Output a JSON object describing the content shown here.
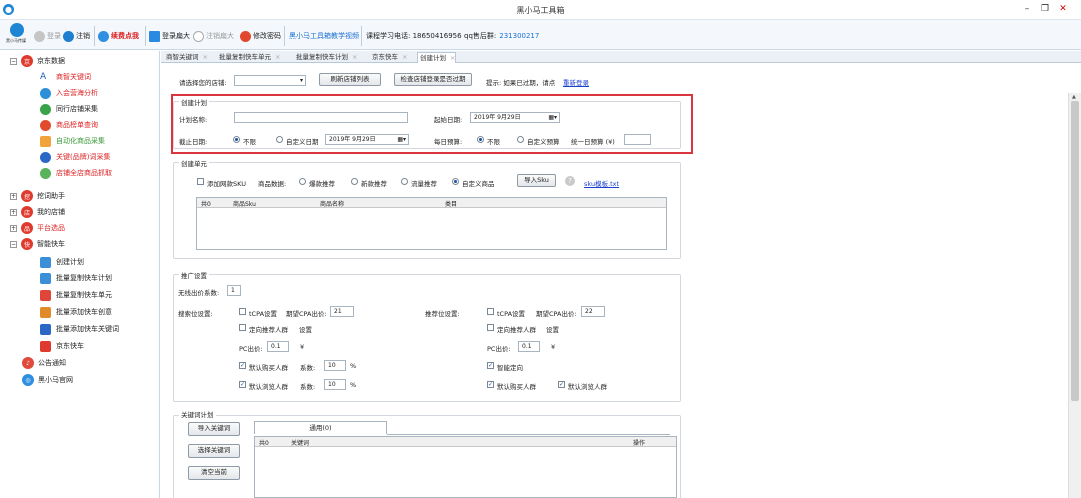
{
  "window": {
    "title": "黑小马工具箱"
  },
  "toolbar": {
    "logo_label": "黑小马传媒",
    "login": "登录",
    "logout": "注销",
    "renew": "续费点我",
    "maximize_login": "登录扁大",
    "logout_maximize": "注销扁大",
    "change_password": "修改密码",
    "tutorial_video": "黑小马工具箱教学视频",
    "course_phone": "课程学习电话: 18650416956",
    "qq_label": "qq售后群:",
    "qq_number": "231300217"
  },
  "sidebar": {
    "jd_data": "京东数据",
    "jd_items": [
      "商智关键词",
      "入会营海分析",
      "同行店铺采集",
      "商品榜单查询",
      "自动化商品采集",
      "关键(品牌)词采集",
      "店铺全店商品抓取"
    ],
    "dig_helper": "挖词助手",
    "my_store": "我的店铺",
    "platform": "平台选品",
    "smart_express": "智能快车",
    "express_items": [
      "创建计划",
      "批量复制快车计划",
      "批量复制快车单元",
      "批量添加快车创意",
      "批量添加快车关键词",
      "京东快车"
    ],
    "announcement": "公告通知",
    "website": "黑小马官网"
  },
  "tabs": [
    "商智关键词",
    "批量复制快车单元",
    "批量复制快车计划",
    "京东快车",
    "创建计划"
  ],
  "top": {
    "select_store": "请选择您的店铺:",
    "refresh_btn": "刷新店铺列表",
    "check_btn": "检查店铺登录是否过期",
    "tip_prefix": "提示: 如果已过期，请点",
    "tip_link": "重新登录"
  },
  "plan": {
    "group": "创建计划",
    "name_label": "计划名称:",
    "name_value": "",
    "start_label": "起始日期:",
    "start_value": "2019年 9月29日",
    "end_label": "截止日期:",
    "end_unlimited": "不限",
    "end_custom": "自定义日期",
    "end_value": "2019年 9月29日",
    "budget_label": "每日预算:",
    "budget_unlimited": "不限",
    "budget_custom": "自定义预算",
    "unified_budget": "统一日预算 (¥)"
  },
  "unit": {
    "group": "创建单元",
    "add_sku": "添加网款SKU",
    "product_data": "商品数据:",
    "opt_hot": "爆款推荐",
    "opt_new": "新款推荐",
    "opt_flow": "流量推荐",
    "opt_custom": "自定义商品",
    "import_sku": "导入Sku",
    "template_link": "sku模板.txt",
    "columns": [
      "共0",
      "商品Sku",
      "商品名称",
      "类目"
    ]
  },
  "promo": {
    "group": "推广设置",
    "wireless_label": "无线出价系数:",
    "wireless_value": "1",
    "search_label": "搜索位设置:",
    "recommend_label": "推荐位设置:",
    "tcpa": "tCPA设置",
    "cpa_label": "期望CPA出价:",
    "search_cpa": "21",
    "recommend_cpa": "22",
    "targeting": "定向推荐人群",
    "set": "设置",
    "pc_label": "PC出价:",
    "pc_value": "0.1",
    "yuan": "¥",
    "default_buyers": "默认购买人群",
    "default_browsers": "默认浏览人群",
    "coefficient": "系数:",
    "buyers_coef": "10",
    "browsers_coef": "10",
    "percent": "%",
    "smart_targeting": "智能定向"
  },
  "keywords": {
    "group": "关键词计划",
    "import_btn": "导入关键词",
    "select_btn": "选择关键词",
    "clear_btn": "清空当前",
    "tab_label": "通用(0)",
    "columns": [
      "共0",
      "关键词",
      "操作"
    ]
  }
}
